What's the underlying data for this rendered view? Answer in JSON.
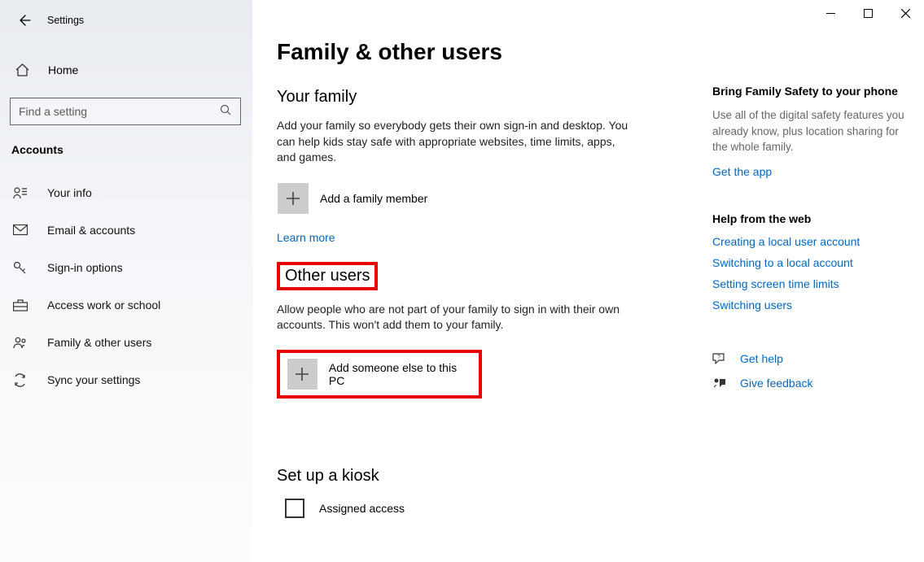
{
  "window": {
    "title": "Settings"
  },
  "sidebar": {
    "home": "Home",
    "search_placeholder": "Find a setting",
    "section": "Accounts",
    "items": [
      {
        "label": "Your info"
      },
      {
        "label": "Email & accounts"
      },
      {
        "label": "Sign-in options"
      },
      {
        "label": "Access work or school"
      },
      {
        "label": "Family & other users"
      },
      {
        "label": "Sync your settings"
      }
    ]
  },
  "main": {
    "title": "Family & other users",
    "family_heading": "Your family",
    "family_desc": "Add your family so everybody gets their own sign-in and desktop. You can help kids stay safe with appropriate websites, time limits, apps, and games.",
    "add_family": "Add a family member",
    "learn_more": "Learn more",
    "other_heading": "Other users",
    "other_desc": "Allow people who are not part of your family to sign in with their own accounts. This won't add them to your family.",
    "add_other": "Add someone else to this PC",
    "kiosk_heading": "Set up a kiosk",
    "assigned_access": "Assigned access"
  },
  "right": {
    "fs_head": "Bring Family Safety to your phone",
    "fs_desc": "Use all of the digital safety features you already know, plus location sharing for the whole family.",
    "get_app": "Get the app",
    "help_head": "Help from the web",
    "help_links": [
      "Creating a local user account",
      "Switching to a local account",
      "Setting screen time limits",
      "Switching users"
    ],
    "get_help": "Get help",
    "feedback": "Give feedback"
  }
}
